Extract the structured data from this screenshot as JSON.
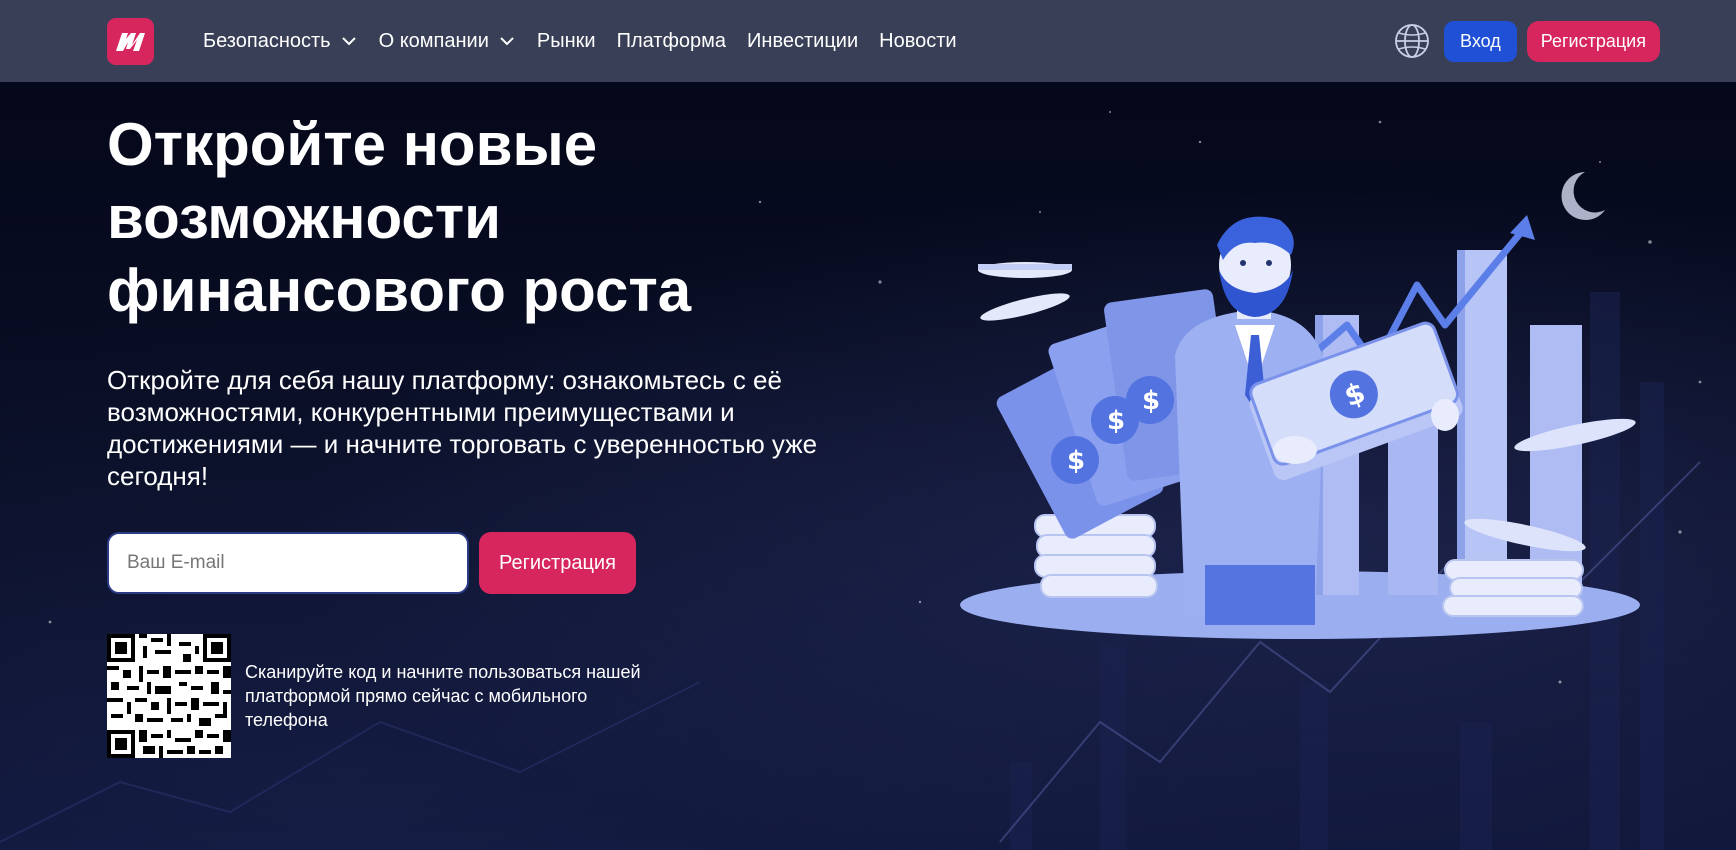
{
  "header": {
    "logo_text": "M",
    "nav": [
      {
        "label": "Безопасность",
        "dropdown": true
      },
      {
        "label": "О компании",
        "dropdown": true
      },
      {
        "label": "Рынки",
        "dropdown": false
      },
      {
        "label": "Платформа",
        "dropdown": false
      },
      {
        "label": "Инвестиции",
        "dropdown": false
      },
      {
        "label": "Новости",
        "dropdown": false
      }
    ],
    "language_icon": "globe-icon",
    "login_label": "Вход",
    "register_label": "Регистрация"
  },
  "hero": {
    "title_lines": [
      "Откройте новые",
      "возможности",
      "финансового роста"
    ],
    "subtitle": "Откройте для себя нашу платформу: ознакомьтесь с её возможностями, конкурентными преимуществами и достижениями — и начните торговать с уверенностью уже сегодня!",
    "email_placeholder": "Ваш E-mail",
    "register_label": "Регистрация",
    "qr_caption": "Сканируйте код и начните пользоваться нашей платформой прямо сейчас с мобильного телефона"
  },
  "colors": {
    "header_bg": "#383f56",
    "brand_pink": "#d7265e",
    "login_blue": "#1f50d6",
    "illustration_blue": "#7f95e8"
  }
}
